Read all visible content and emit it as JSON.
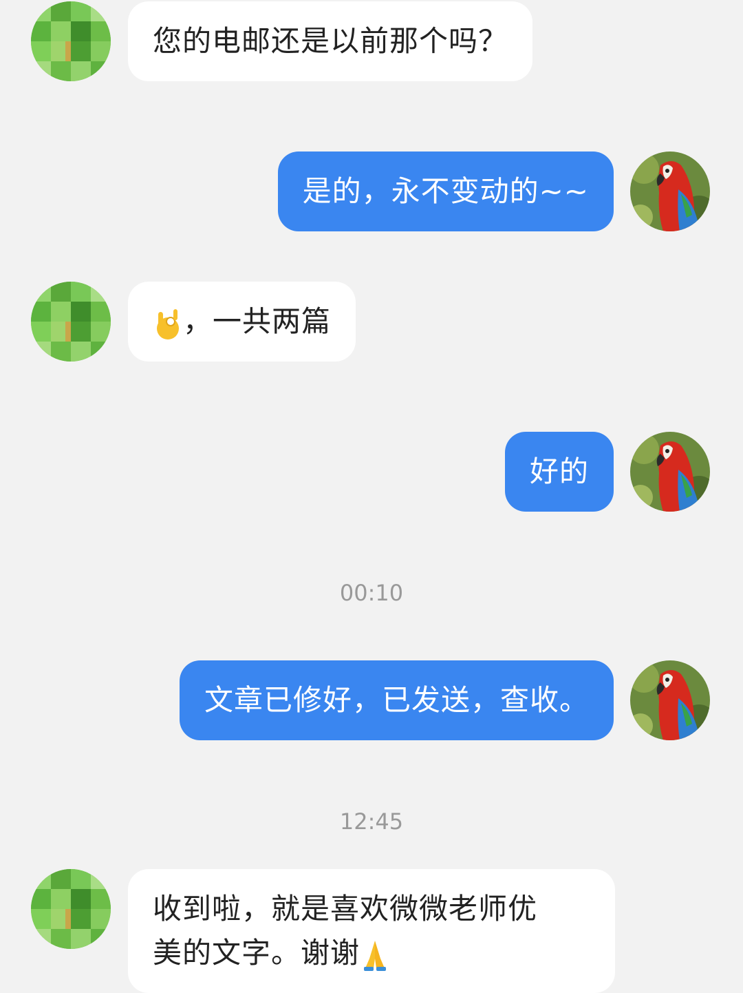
{
  "conversation": {
    "messages": [
      {
        "side": "in",
        "text": "您的电邮还是以前那个吗？"
      },
      {
        "side": "out",
        "text": "是的，永不变动的~~"
      },
      {
        "side": "in",
        "emoji": "ok-hand-icon",
        "text": "，一共两篇"
      },
      {
        "side": "out",
        "text": "好的"
      },
      {
        "side": "out",
        "text": "文章已修好，已发送，查收。"
      },
      {
        "side": "in",
        "text_line1": "收到啦，就是喜欢微微老师优",
        "text_line2": "美的文字。谢谢",
        "emoji": "folded-hands-icon"
      }
    ],
    "timestamps": [
      "00:10",
      "12:45"
    ]
  },
  "colors": {
    "background": "#f2f2f2",
    "incoming_bubble": "#ffffff",
    "outgoing_bubble": "#3a86f0",
    "timestamp_text": "#999999"
  },
  "avatars": {
    "contact": "blurred-green-avatar",
    "self": "parrot-avatar"
  }
}
